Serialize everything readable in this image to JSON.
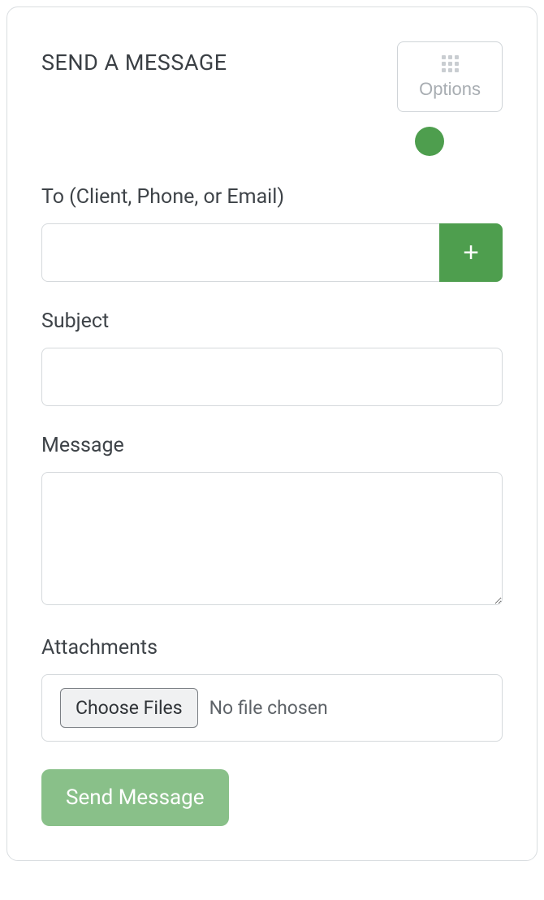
{
  "header": {
    "title": "SEND A MESSAGE",
    "options_label": "Options"
  },
  "status": {
    "color": "#4e9e4e"
  },
  "fields": {
    "to": {
      "label": "To (Client, Phone, or Email)",
      "value": "",
      "add_icon": "+"
    },
    "subject": {
      "label": "Subject",
      "value": ""
    },
    "message": {
      "label": "Message",
      "value": ""
    },
    "attachments": {
      "label": "Attachments",
      "choose_label": "Choose Files",
      "status_text": "No file chosen"
    }
  },
  "submit": {
    "label": "Send Message"
  }
}
